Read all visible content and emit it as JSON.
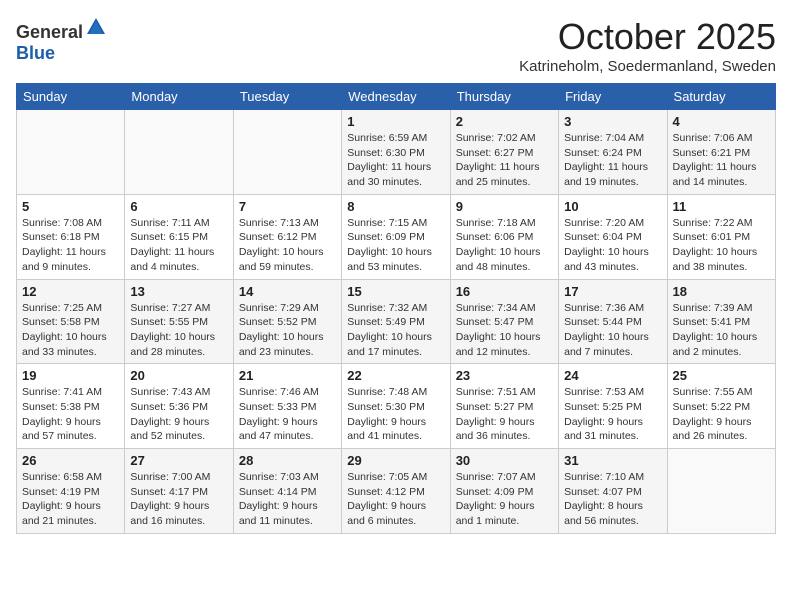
{
  "header": {
    "logo_general": "General",
    "logo_blue": "Blue",
    "month_title": "October 2025",
    "location": "Katrineholm, Soedermanland, Sweden"
  },
  "columns": [
    "Sunday",
    "Monday",
    "Tuesday",
    "Wednesday",
    "Thursday",
    "Friday",
    "Saturday"
  ],
  "weeks": [
    [
      {
        "day": "",
        "info": ""
      },
      {
        "day": "",
        "info": ""
      },
      {
        "day": "",
        "info": ""
      },
      {
        "day": "1",
        "info": "Sunrise: 6:59 AM\nSunset: 6:30 PM\nDaylight: 11 hours\nand 30 minutes."
      },
      {
        "day": "2",
        "info": "Sunrise: 7:02 AM\nSunset: 6:27 PM\nDaylight: 11 hours\nand 25 minutes."
      },
      {
        "day": "3",
        "info": "Sunrise: 7:04 AM\nSunset: 6:24 PM\nDaylight: 11 hours\nand 19 minutes."
      },
      {
        "day": "4",
        "info": "Sunrise: 7:06 AM\nSunset: 6:21 PM\nDaylight: 11 hours\nand 14 minutes."
      }
    ],
    [
      {
        "day": "5",
        "info": "Sunrise: 7:08 AM\nSunset: 6:18 PM\nDaylight: 11 hours\nand 9 minutes."
      },
      {
        "day": "6",
        "info": "Sunrise: 7:11 AM\nSunset: 6:15 PM\nDaylight: 11 hours\nand 4 minutes."
      },
      {
        "day": "7",
        "info": "Sunrise: 7:13 AM\nSunset: 6:12 PM\nDaylight: 10 hours\nand 59 minutes."
      },
      {
        "day": "8",
        "info": "Sunrise: 7:15 AM\nSunset: 6:09 PM\nDaylight: 10 hours\nand 53 minutes."
      },
      {
        "day": "9",
        "info": "Sunrise: 7:18 AM\nSunset: 6:06 PM\nDaylight: 10 hours\nand 48 minutes."
      },
      {
        "day": "10",
        "info": "Sunrise: 7:20 AM\nSunset: 6:04 PM\nDaylight: 10 hours\nand 43 minutes."
      },
      {
        "day": "11",
        "info": "Sunrise: 7:22 AM\nSunset: 6:01 PM\nDaylight: 10 hours\nand 38 minutes."
      }
    ],
    [
      {
        "day": "12",
        "info": "Sunrise: 7:25 AM\nSunset: 5:58 PM\nDaylight: 10 hours\nand 33 minutes."
      },
      {
        "day": "13",
        "info": "Sunrise: 7:27 AM\nSunset: 5:55 PM\nDaylight: 10 hours\nand 28 minutes."
      },
      {
        "day": "14",
        "info": "Sunrise: 7:29 AM\nSunset: 5:52 PM\nDaylight: 10 hours\nand 23 minutes."
      },
      {
        "day": "15",
        "info": "Sunrise: 7:32 AM\nSunset: 5:49 PM\nDaylight: 10 hours\nand 17 minutes."
      },
      {
        "day": "16",
        "info": "Sunrise: 7:34 AM\nSunset: 5:47 PM\nDaylight: 10 hours\nand 12 minutes."
      },
      {
        "day": "17",
        "info": "Sunrise: 7:36 AM\nSunset: 5:44 PM\nDaylight: 10 hours\nand 7 minutes."
      },
      {
        "day": "18",
        "info": "Sunrise: 7:39 AM\nSunset: 5:41 PM\nDaylight: 10 hours\nand 2 minutes."
      }
    ],
    [
      {
        "day": "19",
        "info": "Sunrise: 7:41 AM\nSunset: 5:38 PM\nDaylight: 9 hours\nand 57 minutes."
      },
      {
        "day": "20",
        "info": "Sunrise: 7:43 AM\nSunset: 5:36 PM\nDaylight: 9 hours\nand 52 minutes."
      },
      {
        "day": "21",
        "info": "Sunrise: 7:46 AM\nSunset: 5:33 PM\nDaylight: 9 hours\nand 47 minutes."
      },
      {
        "day": "22",
        "info": "Sunrise: 7:48 AM\nSunset: 5:30 PM\nDaylight: 9 hours\nand 41 minutes."
      },
      {
        "day": "23",
        "info": "Sunrise: 7:51 AM\nSunset: 5:27 PM\nDaylight: 9 hours\nand 36 minutes."
      },
      {
        "day": "24",
        "info": "Sunrise: 7:53 AM\nSunset: 5:25 PM\nDaylight: 9 hours\nand 31 minutes."
      },
      {
        "day": "25",
        "info": "Sunrise: 7:55 AM\nSunset: 5:22 PM\nDaylight: 9 hours\nand 26 minutes."
      }
    ],
    [
      {
        "day": "26",
        "info": "Sunrise: 6:58 AM\nSunset: 4:19 PM\nDaylight: 9 hours\nand 21 minutes."
      },
      {
        "day": "27",
        "info": "Sunrise: 7:00 AM\nSunset: 4:17 PM\nDaylight: 9 hours\nand 16 minutes."
      },
      {
        "day": "28",
        "info": "Sunrise: 7:03 AM\nSunset: 4:14 PM\nDaylight: 9 hours\nand 11 minutes."
      },
      {
        "day": "29",
        "info": "Sunrise: 7:05 AM\nSunset: 4:12 PM\nDaylight: 9 hours\nand 6 minutes."
      },
      {
        "day": "30",
        "info": "Sunrise: 7:07 AM\nSunset: 4:09 PM\nDaylight: 9 hours\nand 1 minute."
      },
      {
        "day": "31",
        "info": "Sunrise: 7:10 AM\nSunset: 4:07 PM\nDaylight: 8 hours\nand 56 minutes."
      },
      {
        "day": "",
        "info": ""
      }
    ]
  ]
}
